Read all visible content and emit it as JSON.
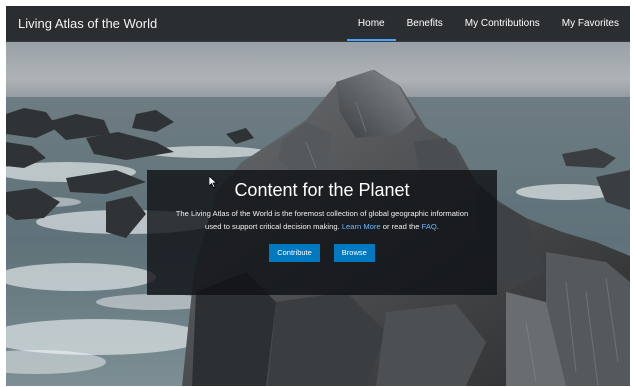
{
  "header": {
    "site_title": "Living Atlas of the World",
    "nav": [
      {
        "label": "Home",
        "active": true
      },
      {
        "label": "Benefits",
        "active": false
      },
      {
        "label": "My Contributions",
        "active": false
      },
      {
        "label": "My Favorites",
        "active": false
      }
    ],
    "active_underline_color": "#4ba3ff"
  },
  "hero": {
    "title": "Content for the Planet",
    "description_part1": "The Living Atlas of the World is the foremost collection of global geographic information used to support critical decision making.",
    "learn_more": "Learn More",
    "description_part2": "or read the",
    "faq": "FAQ",
    "description_end": ".",
    "buttons": {
      "contribute": "Contribute",
      "browse": "Browse"
    },
    "button_color": "#0079c1"
  }
}
